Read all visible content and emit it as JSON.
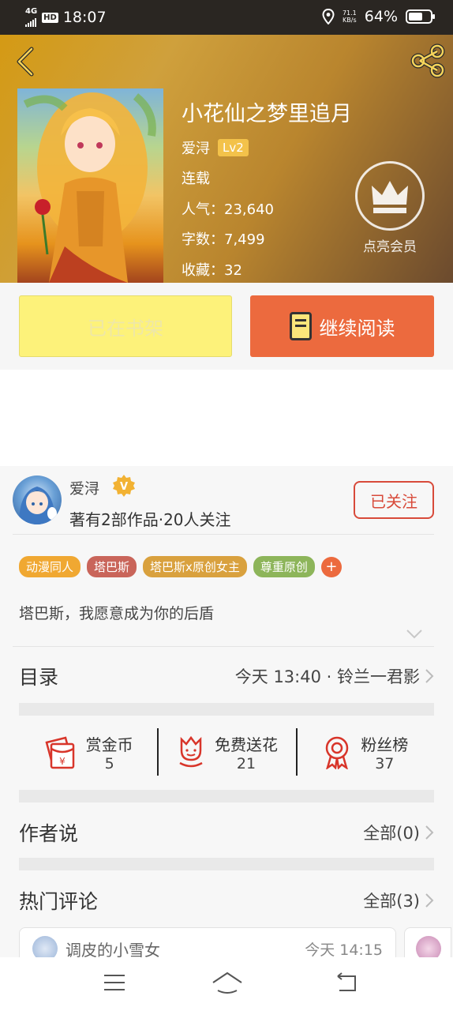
{
  "status_bar": {
    "network": "4G",
    "hd": "HD",
    "time": "18:07",
    "speed_value": "71.1",
    "speed_unit": "KB/s",
    "battery": "64%",
    "battery_level": 0.64
  },
  "book": {
    "title": "小花仙之梦里追月",
    "author": "爱浔",
    "level": "Lv2",
    "status": "连载",
    "popularity": "人气：23,640",
    "word_count": "字数：7,499",
    "favorites": "收藏：32",
    "vip_label": "点亮会员"
  },
  "actions": {
    "shelf_label": "已在书架",
    "read_label": "继续阅读"
  },
  "author_section": {
    "name": "爱浔",
    "stats": "著有2部作品·20人关注",
    "follow_label": "已关注",
    "tags": [
      {
        "label": "动漫同人",
        "color": "#f0a832"
      },
      {
        "label": "塔巴斯",
        "color": "#c9655a"
      },
      {
        "label": "塔巴斯x原创女主",
        "color": "#d9a13e"
      },
      {
        "label": "尊重原创",
        "color": "#8db55a"
      }
    ],
    "add_tag": "+",
    "description": "塔巴斯，我愿意成为你的后盾"
  },
  "toc": {
    "title": "目录",
    "latest": "今天 13:40 · 铃兰一君影"
  },
  "interactions": {
    "reward": {
      "label": "赏金币",
      "count": "5"
    },
    "flowers": {
      "label": "免费送花",
      "count": "21"
    },
    "fans": {
      "label": "粉丝榜",
      "count": "37"
    }
  },
  "author_says": {
    "title": "作者说",
    "link": "全部(0)"
  },
  "hot_comments": {
    "title": "热门评论",
    "link": "全部(3)",
    "first": {
      "user": "调皮的小雪女",
      "time": "今天 14:15"
    }
  },
  "colors": {
    "accent": "#ec6a3e",
    "follow": "#d84a3a",
    "shelf_button": "#fdf27a",
    "icon_red": "#d8352a"
  }
}
